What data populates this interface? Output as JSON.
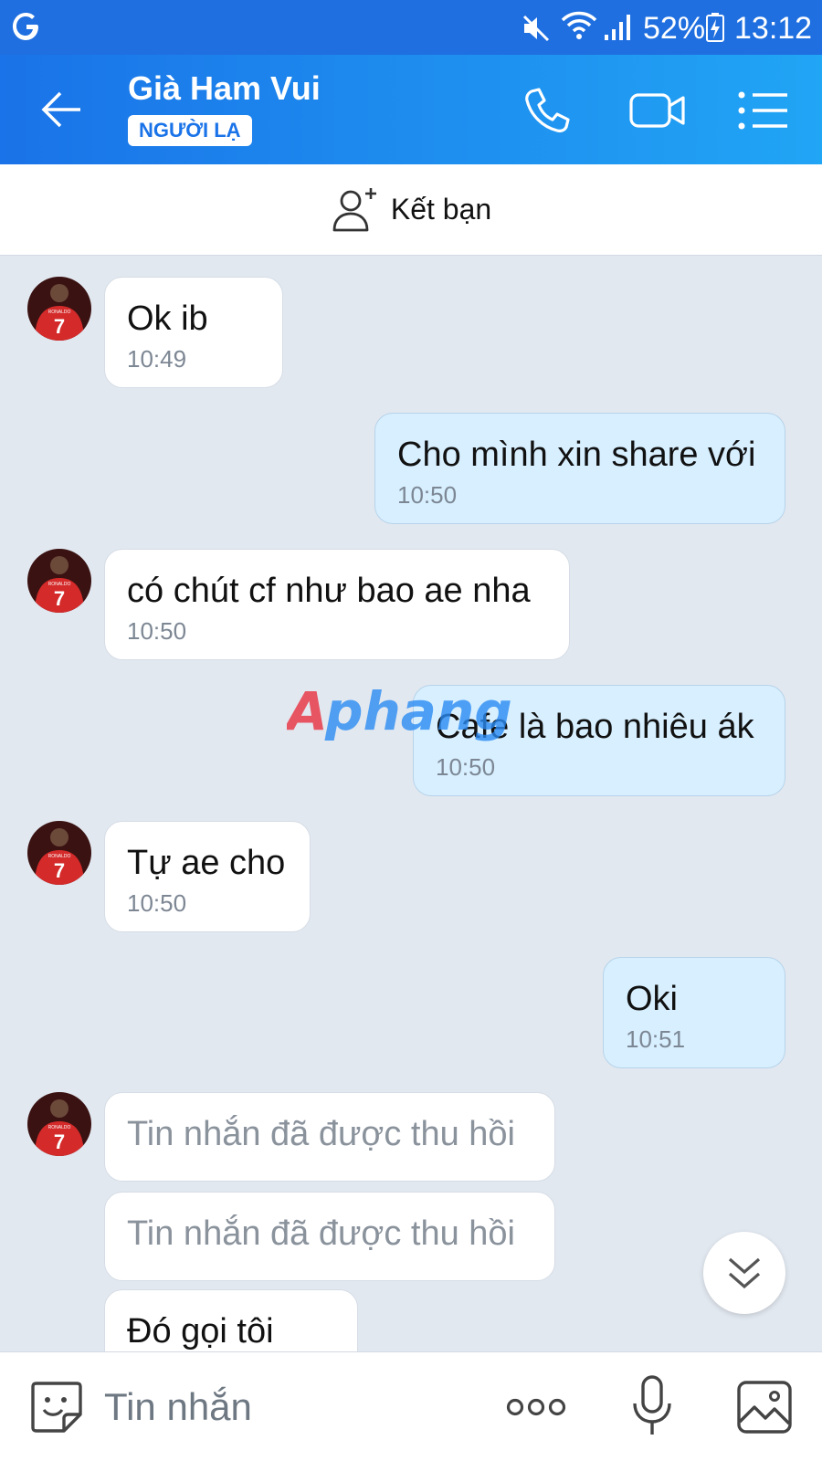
{
  "status_bar": {
    "battery_percent": "52%",
    "time": "13:12",
    "icons": [
      "google-g-icon",
      "mute-icon",
      "wifi-icon",
      "signal-icon",
      "battery-icon"
    ]
  },
  "header": {
    "contact_name": "Già Ham Vui",
    "badge": "NGƯỜI LẠ",
    "icons": [
      "back-arrow-icon",
      "phone-icon",
      "video-icon",
      "menu-list-icon"
    ]
  },
  "add_friend": {
    "label": "Kết bạn",
    "icon": "add-person-icon"
  },
  "messages": [
    {
      "side": "in",
      "text": "Ok ib",
      "time": "10:49"
    },
    {
      "side": "out",
      "text": "Cho mình xin share với",
      "time": "10:50"
    },
    {
      "side": "in",
      "text": "có chút cf như bao ae nha",
      "time": "10:50"
    },
    {
      "side": "out",
      "text": "Cafe là bao nhiêu ák",
      "time": "10:50"
    },
    {
      "side": "in",
      "text": "Tự ae cho",
      "time": "10:50"
    },
    {
      "side": "out",
      "text": "Oki",
      "time": "10:51"
    },
    {
      "side": "in",
      "recalled": "Tin nhắn đã được thu hồi"
    },
    {
      "side": "in",
      "recalled": "Tin nhắn đã được thu hồi"
    },
    {
      "side": "in",
      "text": "Đó gọi tôi"
    }
  ],
  "watermark": "Aphang",
  "composer": {
    "placeholder": "Tin nhắn",
    "icons": [
      "sticker-icon",
      "more-dots-icon",
      "microphone-icon",
      "image-icon"
    ]
  },
  "colors": {
    "header_start": "#1a73e8",
    "header_end": "#21a5f5",
    "chat_background": "#e2e8f0",
    "outgoing_bubble": "#d7efff",
    "incoming_bubble": "#ffffff"
  }
}
